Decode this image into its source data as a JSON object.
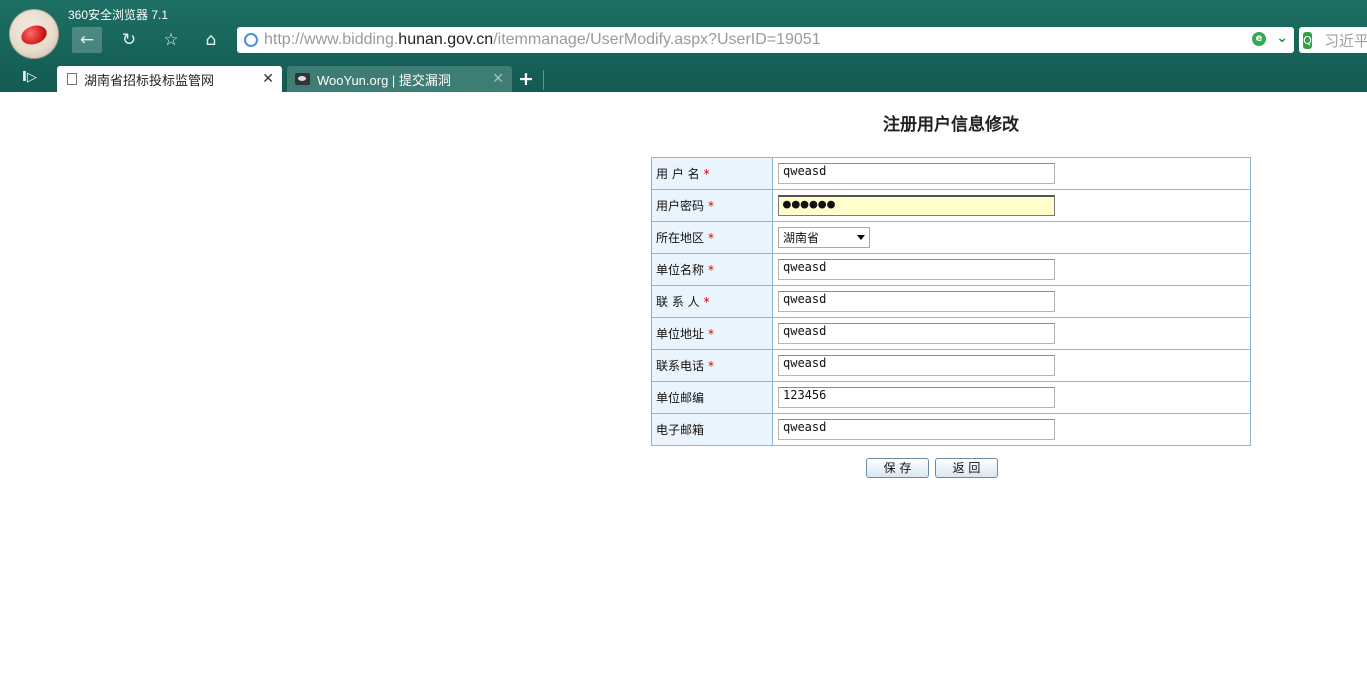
{
  "browser": {
    "app_title": "360安全浏览器 7.1",
    "url_prefix": "http://www.bidding.",
    "url_domain": "hunan.gov.cn",
    "url_path": "/itemmanage/UserModify.aspx?UserID=19051",
    "search_text": "习近平",
    "tabs": [
      {
        "label": "湖南省招标投标监管网",
        "active": true
      },
      {
        "label": "WooYun.org | 提交漏洞",
        "active": false
      }
    ],
    "icons": {
      "back": "←",
      "reload": "↻",
      "favorite": "☆",
      "home": "⌂",
      "close": "✕",
      "new_tab": "+",
      "sidebar": "I▷"
    }
  },
  "page": {
    "title": "注册用户信息修改",
    "required_mark": "*",
    "fields": [
      {
        "label": "用 户 名",
        "value": "qweasd",
        "required": true
      },
      {
        "label": "用户密码",
        "value": "●●●●●●",
        "required": true
      },
      {
        "label": "所在地区",
        "value": "湖南省",
        "required": true
      },
      {
        "label": "单位名称",
        "value": "qweasd",
        "required": true
      },
      {
        "label": "联 系 人",
        "value": "qweasd",
        "required": true
      },
      {
        "label": "单位地址",
        "value": "qweasd",
        "required": true
      },
      {
        "label": "联系电话",
        "value": "qweasd",
        "required": true
      },
      {
        "label": "单位邮编",
        "value": "123456",
        "required": false
      },
      {
        "label": "电子邮箱",
        "value": "qweasd",
        "required": false
      }
    ],
    "buttons": {
      "save": "保 存",
      "back": "返 回"
    }
  }
}
